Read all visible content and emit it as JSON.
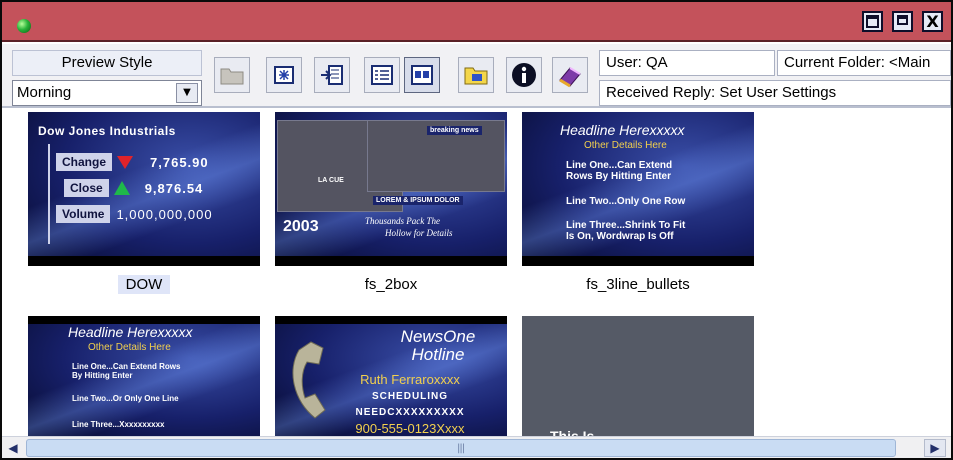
{
  "window": {
    "controls": [
      "minimize-icon",
      "maximize-icon",
      "close-icon"
    ],
    "close_glyph": "X"
  },
  "toolbar": {
    "preview_style_label": "Preview Style",
    "preview_style_value": "Morning",
    "buttons": [
      "folder-icon",
      "new-folder-icon",
      "import-icon",
      "list-view-icon",
      "thumbnail-view-icon",
      "folder-search-icon",
      "info-icon",
      "erase-icon"
    ]
  },
  "status": {
    "user": "User: QA",
    "current_folder": "Current Folder: <Main",
    "reply": "Received Reply: Set User Settings"
  },
  "templates": [
    {
      "name": "DOW",
      "selected": true,
      "preview": {
        "title": "Dow Jones Industrials",
        "rows": [
          {
            "label": "Change",
            "value": "7,765.90"
          },
          {
            "label": "Close",
            "value": "9,876.54"
          },
          {
            "label": "Volume",
            "value": "1,000,000,000"
          }
        ]
      }
    },
    {
      "name": "fs_2box",
      "selected": false,
      "preview": {
        "tag_top": "breaking news",
        "tag_mid": "LA CUE",
        "tag_low": "LOREM & IPSUM DOLOR",
        "year": "2003",
        "sub1": "Thousands Pack The",
        "sub2": "Hollow for Details"
      }
    },
    {
      "name": "fs_3line_bullets",
      "selected": false,
      "preview": {
        "headline": "Headline Herexxxxx",
        "other": "Other Details Here",
        "lines": [
          "Line One...Can Extend",
          "Rows By Hitting Enter",
          "Line Two...Only One Row",
          "Line Three...Shrink To Fit",
          "Is On, Wordwrap Is Off"
        ]
      }
    },
    {
      "name": "",
      "selected": false,
      "preview": {
        "headline": "Headline Herexxxxx",
        "other": "Other Details Here",
        "lines": [
          "Line One...Can Extend Rows",
          "By Hitting Enter",
          "Line Two...Or Only One Line",
          "Line Three...Xxxxxxxxxx"
        ]
      }
    },
    {
      "name": "",
      "selected": false,
      "preview": {
        "title1": "NewsOne",
        "title2": "Hotline",
        "person": "Ruth Ferraroxxxx",
        "dept": "SCHEDULING",
        "sub": "NEEDCXXXXXXXXX",
        "phone": "900-555-0123Xxxx"
      }
    },
    {
      "name": "",
      "selected": false,
      "preview": {
        "partial_text": "This Is"
      }
    }
  ],
  "scrollbar": {
    "grip": "|||"
  },
  "colors": {
    "titlebar": "#c4525b",
    "selection": "#dfe5f8",
    "thumb_bg": "#17206a",
    "accent_yellow": "#f2d04e"
  }
}
